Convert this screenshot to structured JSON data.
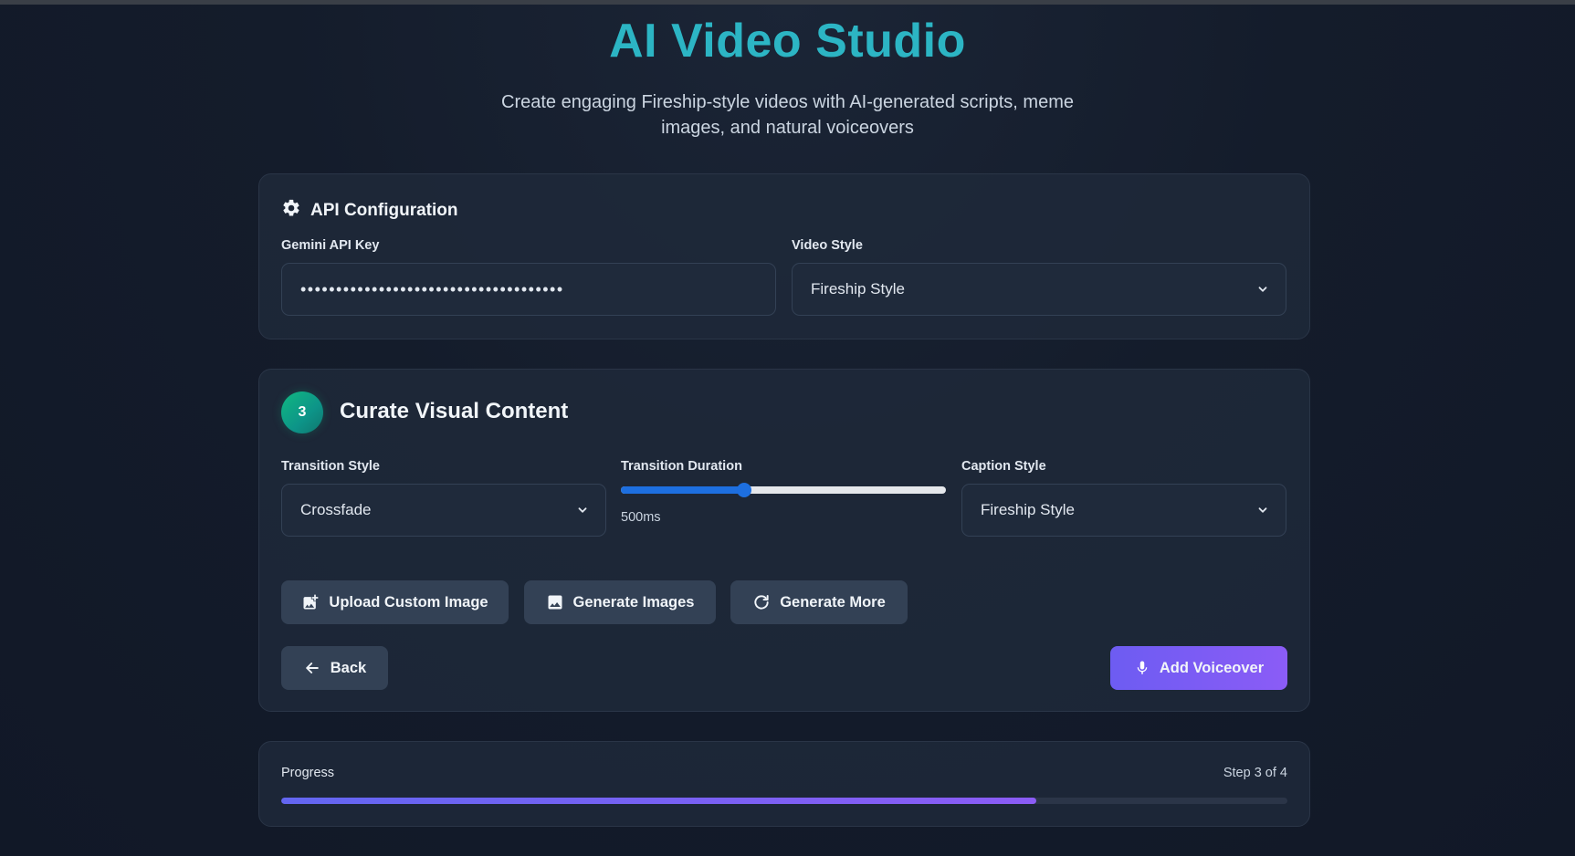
{
  "header": {
    "title": "AI Video Studio",
    "subtitle": "Create engaging Fireship-style videos with AI-generated scripts, meme images, and natural voiceovers"
  },
  "api_config": {
    "heading": "API Configuration",
    "icon": "gear-icon",
    "api_key_label": "Gemini API Key",
    "api_key_value": "•••••••••••••••••••••••••••••••••••••",
    "video_style_label": "Video Style",
    "video_style_value": "Fireship Style"
  },
  "step": {
    "number": "3",
    "title": "Curate Visual Content",
    "transition_style_label": "Transition Style",
    "transition_style_value": "Crossfade",
    "transition_duration_label": "Transition Duration",
    "transition_duration_value": "500ms",
    "transition_duration_fraction": 0.38,
    "caption_style_label": "Caption Style",
    "caption_style_value": "Fireship Style",
    "buttons": {
      "upload": "Upload Custom Image",
      "generate_images": "Generate Images",
      "generate_more": "Generate More",
      "back": "Back",
      "add_voiceover": "Add Voiceover"
    }
  },
  "progress": {
    "label": "Progress",
    "step_text": "Step 3 of 4",
    "fraction": 0.75
  },
  "colors": {
    "title": "#2cb5c4",
    "accent_purple": "#8b5cf6",
    "slider_blue": "#1d6fe0",
    "badge_green": "#10b981"
  }
}
